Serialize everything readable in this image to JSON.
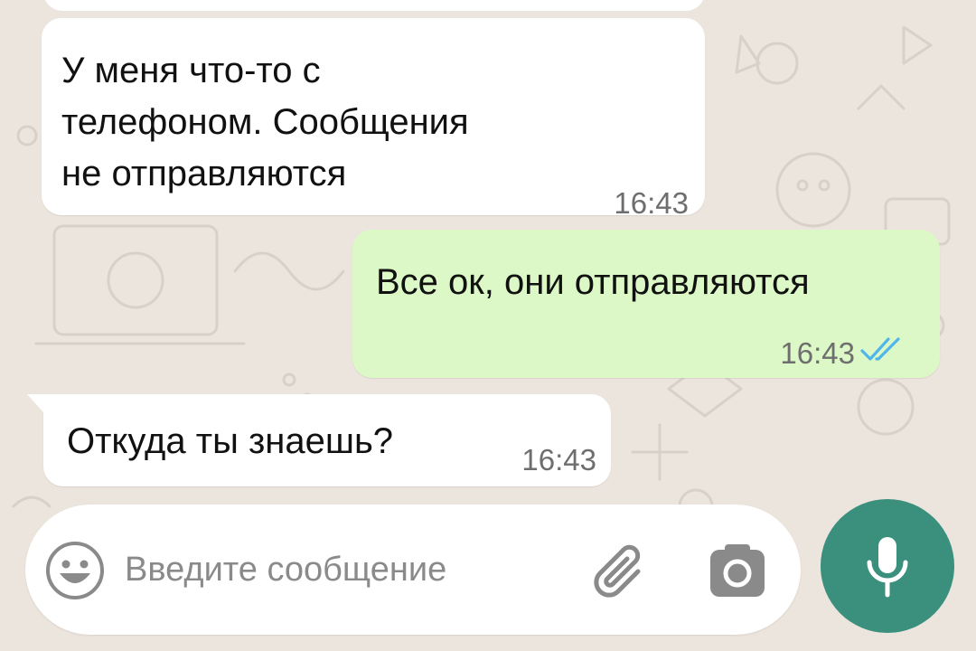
{
  "chat": {
    "messages": [
      {
        "direction": "incoming",
        "lines": [
          "У меня что-то с",
          "телефоном. Сообщения",
          "не отправляются"
        ],
        "time": "16:43"
      },
      {
        "direction": "outgoing",
        "text": "Все ок, они отправляются",
        "time": "16:43",
        "status_icon": "double-check-read-icon"
      },
      {
        "direction": "incoming",
        "text": "Откуда ты знаешь?",
        "time": "16:43"
      }
    ]
  },
  "composer": {
    "placeholder": "Введите сообщение",
    "value": "",
    "icons": [
      "emoji-icon",
      "paperclip-icon",
      "camera-icon",
      "microphone-icon"
    ]
  },
  "colors": {
    "background": "#ece5dd",
    "incoming_bubble": "#ffffff",
    "outgoing_bubble": "#dcf8c6",
    "read_ticks": "#4fb6ec",
    "mic_button": "#3a8f7d"
  }
}
